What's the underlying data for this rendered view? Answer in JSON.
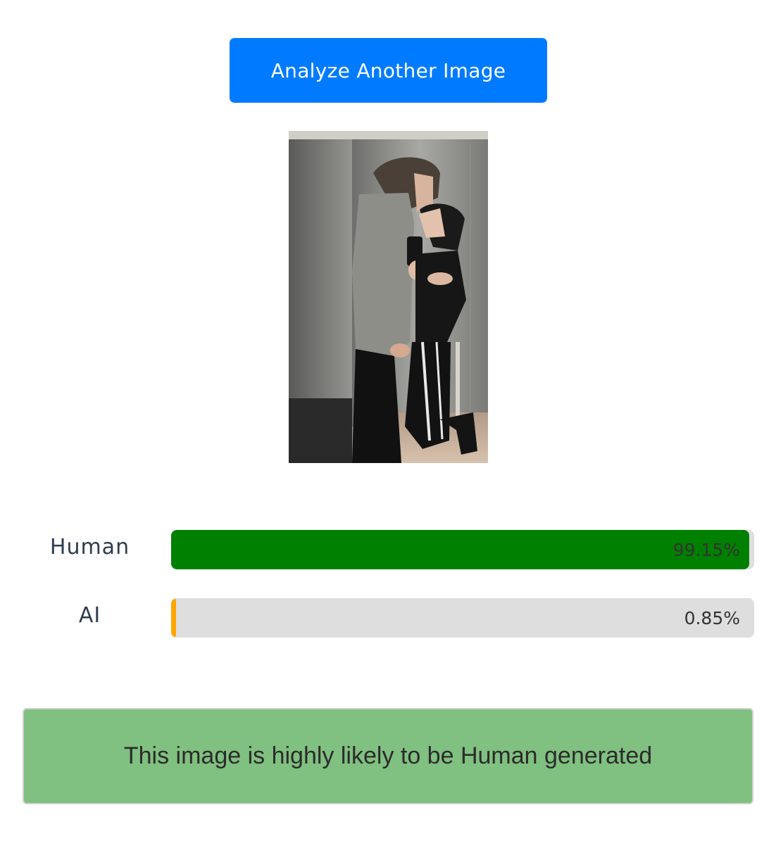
{
  "actions": {
    "analyze_label": "Analyze Another Image"
  },
  "results": {
    "rows": [
      {
        "label": "Human",
        "value_text": "99.15%",
        "fraction": 0.9915,
        "color": "#008000"
      },
      {
        "label": "AI",
        "value_text": "0.85%",
        "fraction": 0.0085,
        "color": "#ffa500"
      }
    ],
    "verdict": "This image is highly likely to be Human generated"
  },
  "colors": {
    "primary_button": "#007bff",
    "track": "#dedede",
    "verdict_bg": "#80c080"
  }
}
